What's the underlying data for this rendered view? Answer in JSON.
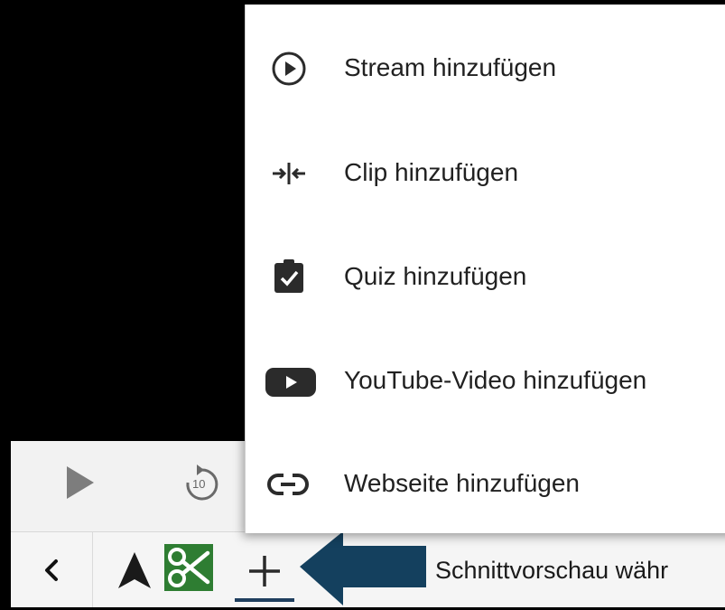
{
  "menu": {
    "items": [
      {
        "label": "Stream hinzufügen",
        "icon": "play-circle-icon"
      },
      {
        "label": "Clip hinzufügen",
        "icon": "split-arrows-icon"
      },
      {
        "label": "Quiz hinzufügen",
        "icon": "clipboard-check-icon"
      },
      {
        "label": "YouTube-Video hinzufügen",
        "icon": "youtube-icon"
      },
      {
        "label": "Webseite hinzufügen",
        "icon": "link-icon"
      }
    ]
  },
  "player": {
    "rewind_seconds": "10",
    "play_icon": "play-icon",
    "rewind_icon": "replay-10-icon"
  },
  "toolbar": {
    "hint_text": "Schnittvorschau währ",
    "icons": [
      "chevron-left-icon",
      "navigation-arrow-icon",
      "scissors-icon",
      "plus-icon"
    ],
    "active_accent": "#1f3e5e",
    "scissors_bg": "#2e7d32"
  },
  "annotation": {
    "arrow_color": "#14405e"
  }
}
